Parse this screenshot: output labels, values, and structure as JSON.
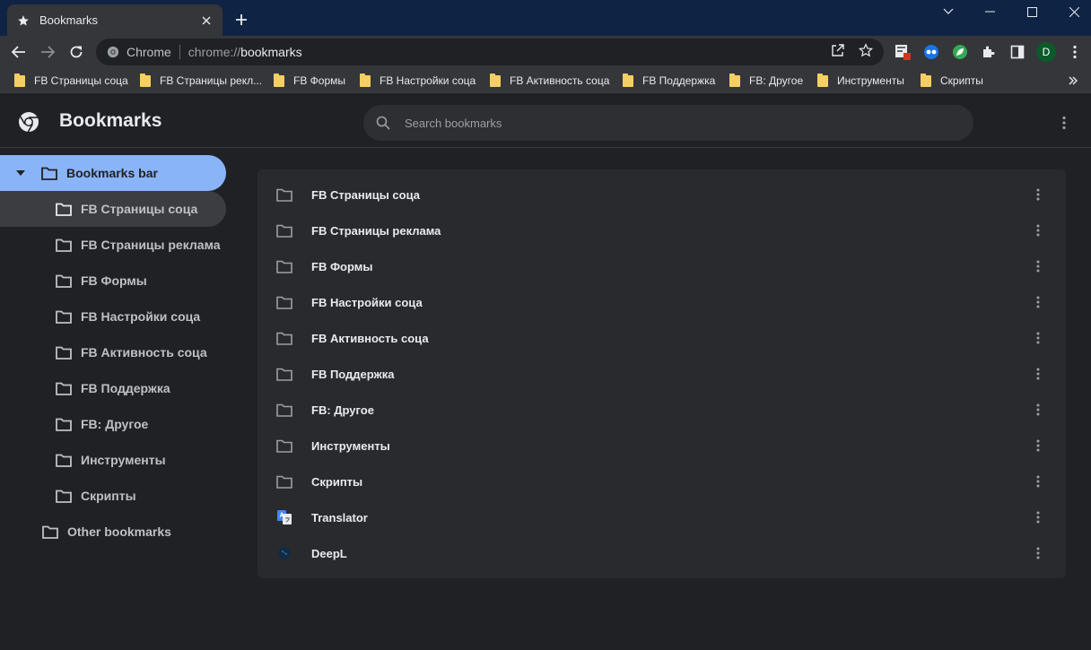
{
  "tab": {
    "title": "Bookmarks"
  },
  "omnibox": {
    "site_name": "Chrome",
    "url_scheme": "chrome://",
    "url_host": "bookmarks"
  },
  "profile": {
    "initial": "D"
  },
  "bookmarks_bar": [
    "FB Страницы соца",
    "FB Страницы рекл...",
    "FB Формы",
    "FB Настройки соца",
    "FB Активность соца",
    "FB Поддержка",
    "FB: Другое",
    "Инструменты",
    "Скрипты"
  ],
  "header": {
    "title": "Bookmarks",
    "search_placeholder": "Search bookmarks"
  },
  "sidebar": {
    "root": "Bookmarks bar",
    "children": [
      "FB Страницы соца",
      "FB Страницы реклама",
      "FB Формы",
      "FB Настройки соца",
      "FB Активность соца",
      "FB Поддержка",
      "FB: Другое",
      "Инструменты",
      "Скрипты"
    ],
    "other": "Other bookmarks"
  },
  "list": [
    {
      "label": "FB Страницы соца",
      "icon": "folder-icon"
    },
    {
      "label": "FB Страницы реклама",
      "icon": "folder-icon"
    },
    {
      "label": "FB Формы",
      "icon": "folder-icon"
    },
    {
      "label": "FB Настройки соца",
      "icon": "folder-icon"
    },
    {
      "label": "FB Активность соца",
      "icon": "folder-icon"
    },
    {
      "label": "FB Поддержка",
      "icon": "folder-icon"
    },
    {
      "label": "FB: Другое",
      "icon": "folder-icon"
    },
    {
      "label": "Инструменты",
      "icon": "folder-icon"
    },
    {
      "label": "Скрипты",
      "icon": "folder-icon"
    },
    {
      "label": "Translator",
      "icon": "google-translate-icon"
    },
    {
      "label": "DeepL",
      "icon": "deepl-icon"
    }
  ],
  "colors": {
    "accent": "#8ab4f8",
    "frame": "#0f2445",
    "toolbar": "#35363a",
    "page": "#202124",
    "card": "#292a2d",
    "bookmark_folder": "#f6cf62"
  }
}
